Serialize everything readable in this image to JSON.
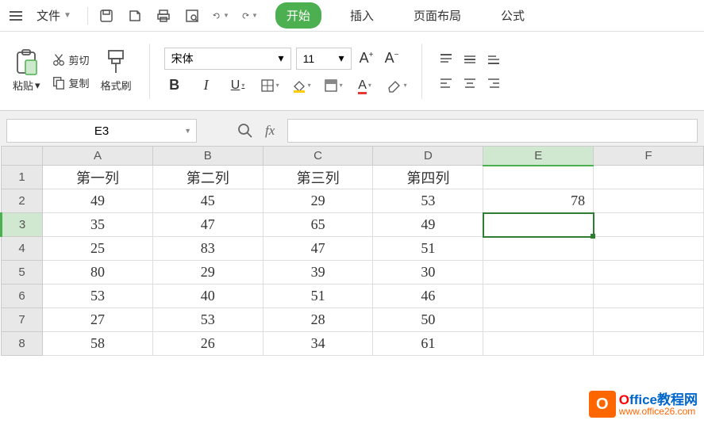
{
  "menu": {
    "file_label": "文件",
    "tabs": [
      "开始",
      "插入",
      "页面布局",
      "公式"
    ],
    "active_tab": "开始"
  },
  "ribbon": {
    "paste_label": "粘贴",
    "cut_label": "剪切",
    "copy_label": "复制",
    "format_painter_label": "格式刷",
    "font_name": "宋体",
    "font_size": "11",
    "increase_font": "A⁺",
    "decrease_font": "A⁻"
  },
  "formula_bar": {
    "cell_ref": "E3",
    "fx_label": "fx",
    "formula_value": ""
  },
  "sheet": {
    "columns": [
      "A",
      "B",
      "C",
      "D",
      "E",
      "F"
    ],
    "row_headers": [
      1,
      2,
      3,
      4,
      5,
      6,
      7,
      8
    ],
    "active_cell": "E3",
    "active_col": "E",
    "active_row": 3,
    "headers_row": [
      "第一列",
      "第二列",
      "第三列",
      "第四列",
      "",
      ""
    ],
    "data": [
      [
        49,
        45,
        29,
        53,
        78,
        ""
      ],
      [
        35,
        47,
        65,
        49,
        "",
        ""
      ],
      [
        25,
        83,
        47,
        51,
        "",
        ""
      ],
      [
        80,
        29,
        39,
        30,
        "",
        ""
      ],
      [
        53,
        40,
        51,
        46,
        "",
        ""
      ],
      [
        27,
        53,
        28,
        50,
        "",
        ""
      ],
      [
        58,
        26,
        34,
        61,
        "",
        ""
      ]
    ]
  },
  "watermark": {
    "title_prefix": "O",
    "title_rest": "ffice教程网",
    "url": "www.office26.com",
    "icon_letter": "O"
  },
  "chart_data": {
    "type": "table",
    "columns": [
      "第一列",
      "第二列",
      "第三列",
      "第四列"
    ],
    "rows": [
      [
        49,
        45,
        29,
        53
      ],
      [
        35,
        47,
        65,
        49
      ],
      [
        25,
        83,
        47,
        51
      ],
      [
        80,
        29,
        39,
        30
      ],
      [
        53,
        40,
        51,
        46
      ],
      [
        27,
        53,
        28,
        50
      ],
      [
        58,
        26,
        34,
        61
      ]
    ],
    "extra": {
      "E2": 78
    }
  }
}
